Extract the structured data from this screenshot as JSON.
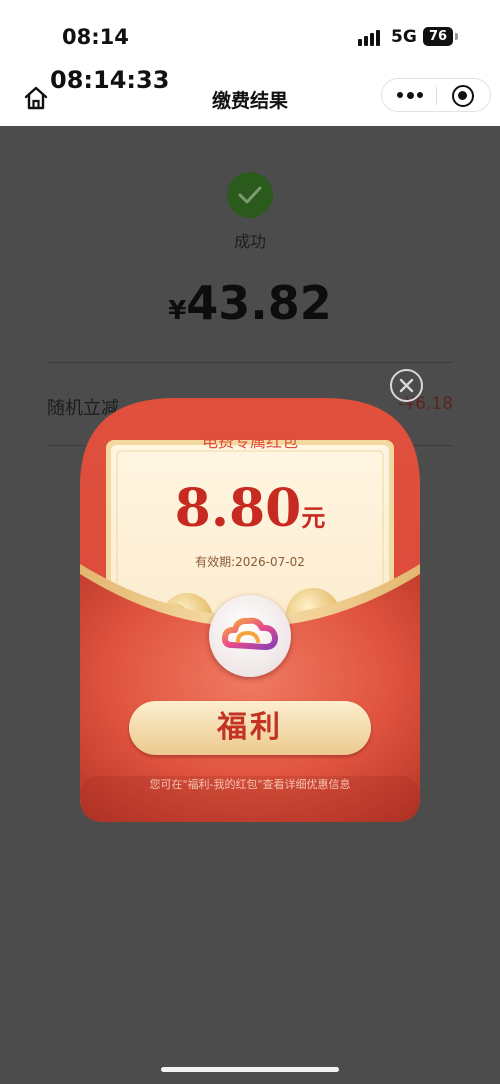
{
  "status_bar": {
    "time": "08:14",
    "network": "5G",
    "battery": "76"
  },
  "overlay_time": "08:14:33",
  "nav": {
    "title": "缴费结果"
  },
  "icons": {
    "home": "home-icon",
    "more": "more-icon",
    "target": "target-icon",
    "success": "check-circle-icon",
    "close": "close-icon",
    "logo": "cloud-logo-icon"
  },
  "result": {
    "status_label": "成功",
    "currency_symbol": "¥",
    "amount": "43.82",
    "discount_label": "随机立减",
    "discount_value": "-¥6.18"
  },
  "red_packet": {
    "title": "电费专属红包",
    "amount": "8.80",
    "unit": "元",
    "validity": "有效期:2026-07-02",
    "button_label": "福利",
    "tip": "您可在\"福利-我的红包\"查看详细优惠信息"
  },
  "colors": {
    "packet_red": "#df4d3b",
    "card_cream": "#fdf3dc",
    "gold": "#e8c27f",
    "amount_red": "#c62a20",
    "success_green": "#2a5a1c"
  }
}
